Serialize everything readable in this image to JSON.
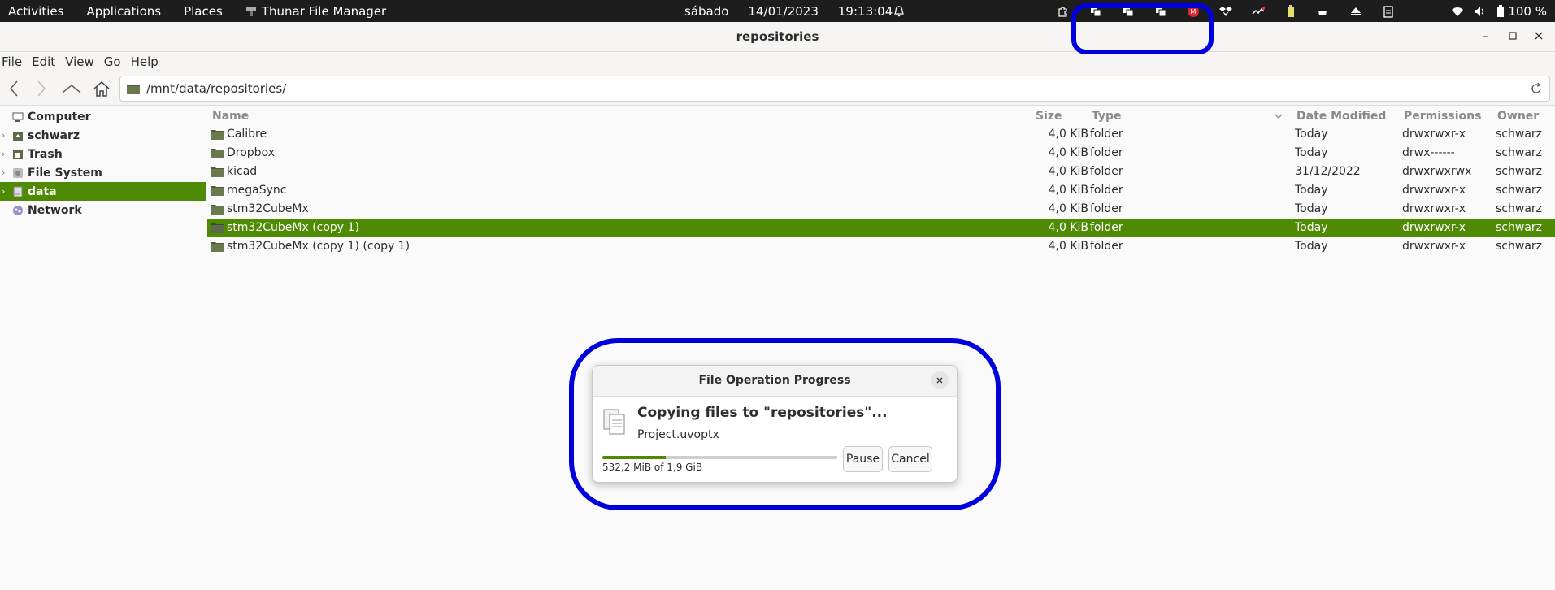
{
  "topbar": {
    "activities": "Activities",
    "applications": "Applications",
    "places": "Places",
    "app_name": "Thunar File Manager",
    "day": "sábado",
    "date": "14/01/2023",
    "time": "19:13:04",
    "battery": "100 %"
  },
  "window": {
    "title": "repositories"
  },
  "menu": [
    "File",
    "Edit",
    "View",
    "Go",
    "Help"
  ],
  "location": {
    "path": "/mnt/data/repositories/"
  },
  "sidebar": {
    "items": [
      {
        "label": "Computer",
        "icon": "computer-icon"
      },
      {
        "label": "schwarz",
        "icon": "home-folder-icon"
      },
      {
        "label": "Trash",
        "icon": "trash-icon"
      },
      {
        "label": "File System",
        "icon": "drive-icon"
      },
      {
        "label": "data",
        "icon": "disk-icon"
      },
      {
        "label": "Network",
        "icon": "network-icon"
      }
    ]
  },
  "columns": {
    "name": "Name",
    "size": "Size",
    "type": "Type",
    "date": "Date Modified",
    "perm": "Permissions",
    "owner": "Owner"
  },
  "files": [
    {
      "name": "Calibre",
      "size": "4,0 KiB",
      "type": "folder",
      "date": "Today",
      "perm": "drwxrwxr-x",
      "owner": "schwarz"
    },
    {
      "name": "Dropbox",
      "size": "4,0 KiB",
      "type": "folder",
      "date": "Today",
      "perm": "drwx------",
      "owner": "schwarz"
    },
    {
      "name": "kicad",
      "size": "4,0 KiB",
      "type": "folder",
      "date": "31/12/2022",
      "perm": "drwxrwxrwx",
      "owner": "schwarz"
    },
    {
      "name": "megaSync",
      "size": "4,0 KiB",
      "type": "folder",
      "date": "Today",
      "perm": "drwxrwxr-x",
      "owner": "schwarz"
    },
    {
      "name": "stm32CubeMx",
      "size": "4,0 KiB",
      "type": "folder",
      "date": "Today",
      "perm": "drwxrwxr-x",
      "owner": "schwarz"
    },
    {
      "name": "stm32CubeMx (copy 1)",
      "size": "4,0 KiB",
      "type": "folder",
      "date": "Today",
      "perm": "drwxrwxr-x",
      "owner": "schwarz"
    },
    {
      "name": "stm32CubeMx (copy 1) (copy 1)",
      "size": "4,0 KiB",
      "type": "folder",
      "date": "Today",
      "perm": "drwxrwxr-x",
      "owner": "schwarz"
    }
  ],
  "dialog": {
    "title": "File Operation Progress",
    "heading": "Copying files to \"repositories\"...",
    "current_file": "Project.uvoptx",
    "status": "532,2 MiB of 1,9 GiB",
    "progress": 0.27,
    "pause": "Pause",
    "cancel": "Cancel"
  },
  "colors": {
    "accent": "#4e8a04",
    "highlight": "#0000dd",
    "topbar": "#1d1d1d"
  }
}
